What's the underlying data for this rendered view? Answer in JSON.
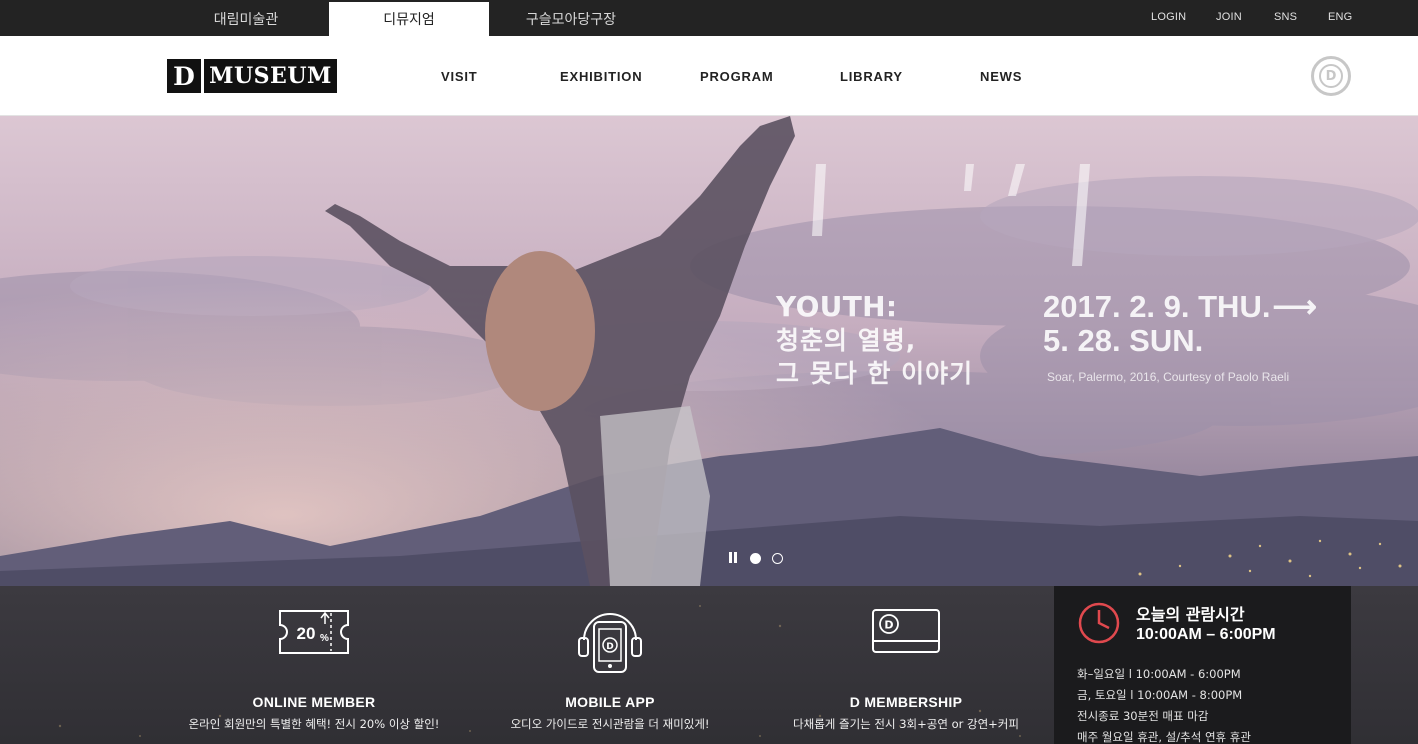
{
  "top_bar": {
    "site_tabs": [
      {
        "label": "대림미술관",
        "active": false
      },
      {
        "label": "디뮤지엄",
        "active": true
      },
      {
        "label": "구슬모아당구장",
        "active": false
      }
    ],
    "utility_links": [
      "LOGIN",
      "JOIN",
      "SNS",
      "ENG"
    ]
  },
  "header": {
    "logo": {
      "mark": "D",
      "word": "MUSEUM"
    },
    "nav": [
      "VISIT",
      "EXHIBITION",
      "PROGRAM",
      "LIBRARY",
      "NEWS"
    ],
    "badge_letter": "D"
  },
  "hero": {
    "title": "YOUTH:",
    "subtitle_line1": "청춘의 열병,",
    "subtitle_line2": "그 못다 한 이야기",
    "date_line1": "2017. 2. 9. THU.",
    "date_arrow": "⟶",
    "date_line2": "5. 28. SUN.",
    "credit": "Soar, Palermo, 2016, Courtesy of Paolo Raeli",
    "slides": 2,
    "active_slide": 1
  },
  "services": [
    {
      "icon": "coupon-20-percent-icon",
      "icon_text": "20",
      "icon_unit": "%",
      "title": "ONLINE MEMBER",
      "desc": "온라인 회원만의 특별한 혜택! 전시 20% 이상 할인!"
    },
    {
      "icon": "mobile-app-icon",
      "icon_text": "D",
      "title": "MOBILE APP",
      "desc": "오디오 가이드로 전시관람을 더 재미있게!"
    },
    {
      "icon": "membership-card-icon",
      "icon_text": "D",
      "title": "D MEMBERSHIP",
      "desc": "다채롭게 즐기는 전시 3회+공연 or 강연+커피"
    }
  ],
  "hours": {
    "icon": "clock-icon",
    "label": "오늘의 관람시간",
    "time": "10:00AM – 6:00PM",
    "lines": [
      "화–일요일 l 10:00AM  -  6:00PM",
      "금, 토요일 l 10:00AM  -  8:00PM",
      "전시종료 30분전 매표 마감",
      "매주 월요일 휴관, 설/추석 연휴 휴관"
    ]
  },
  "colors": {
    "topbar": "#232323",
    "accent_red": "#e0494e",
    "hours_panel": "#1b1b1d"
  }
}
